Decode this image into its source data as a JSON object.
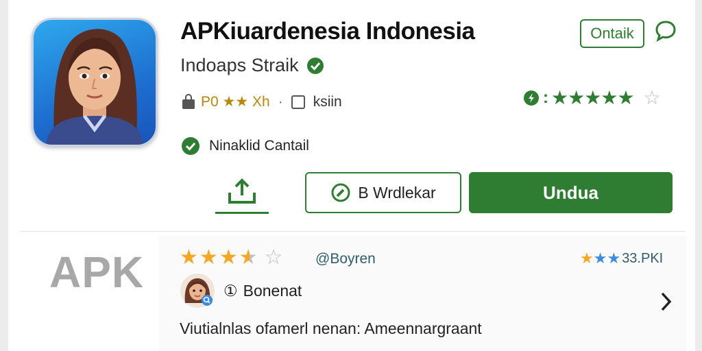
{
  "app": {
    "title": "APKiuardenesia Indonesia",
    "developer": "Indoaps Straik",
    "meta": {
      "rating": "P0 ★★ Xh",
      "separator": "·",
      "label": "ksiin"
    },
    "status": "Ninaklid Cantail"
  },
  "header": {
    "contact_label": "Ontaik",
    "rating_prefix": "0:",
    "rating_stars_filled": 5,
    "rating_stars_total": 6
  },
  "actions": {
    "wishlist_label": "B Wrdlekar",
    "download_label": "Undua"
  },
  "review_section": {
    "watermark": "APK",
    "stars_value": 3.5,
    "stars_total": 5,
    "author_tag": "@Boyren",
    "count": "33.PKI",
    "reviewer_name": "Bonenat",
    "reviewer_badge": "①",
    "text": "Viutialnlas ofamerl  nenan: Ameennargraant"
  },
  "colors": {
    "accent_green": "#2e7d32",
    "star_orange": "#f5a623",
    "star_blue": "#3a8dde"
  },
  "icons": [
    "verified-icon",
    "bag-icon",
    "checkbox-icon",
    "check-circle-icon",
    "chat-icon",
    "star-icon",
    "share-icon",
    "wishlist-icon",
    "chevron-right-icon",
    "avatar"
  ]
}
